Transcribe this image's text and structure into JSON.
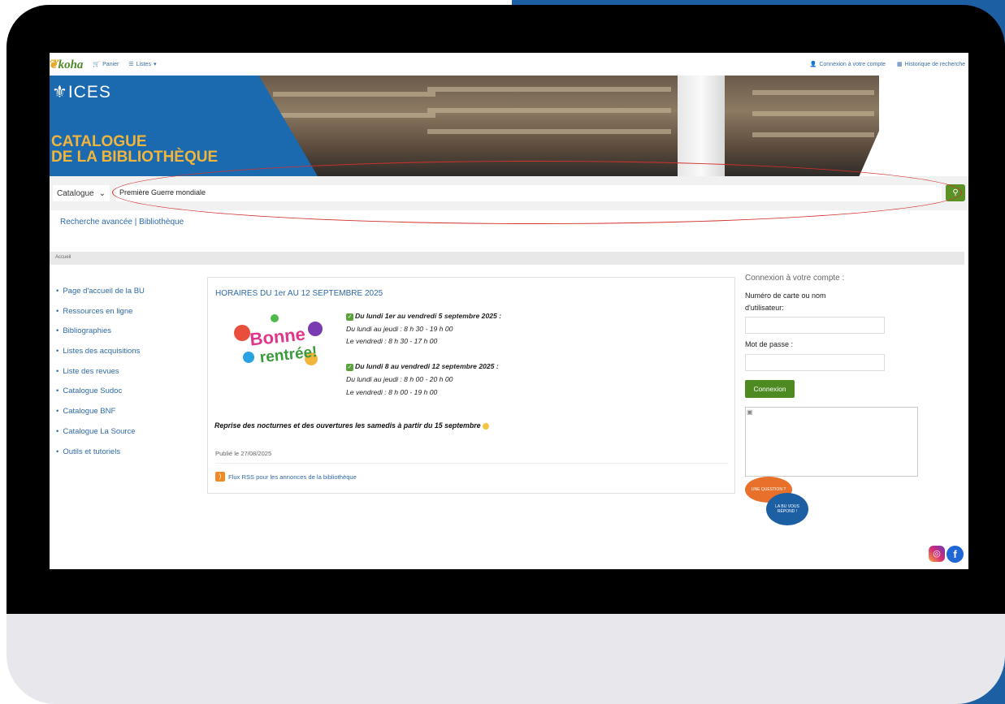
{
  "topnav": {
    "logo": "koha",
    "cart_label": "Panier",
    "lists_label": "Listes",
    "login_label": "Connexion à votre compte",
    "history_label": "Historique de recherche"
  },
  "banner": {
    "org": "ICES",
    "title_line1": "CATALOGUE",
    "title_line2": "DE LA BIBLIOTHÈQUE"
  },
  "search": {
    "scope": "Catalogue",
    "query": "Première Guerre mondiale",
    "advanced_label": "Recherche avancée | Bibliothèque"
  },
  "breadcrumb": "Accueil",
  "sidebar": {
    "items": [
      "Page d'accueil de la BU",
      "Ressources en ligne",
      "Bibliographies",
      "Listes des acquisitions",
      "Liste des revues",
      "Catalogue Sudoc",
      "Catalogue BNF",
      "Catalogue La Source",
      "Outils et tutoriels"
    ]
  },
  "news": {
    "title": "HORAIRES DU 1er AU 12 SEPTEMBRE 2025",
    "image_text1": "Bonne",
    "image_text2": "rentrée!",
    "period1_heading": "Du lundi 1er au vendredi 5 septembre 2025 :",
    "period1_line1": "Du lundi au jeudi : 8 h 30 - 19 h 00",
    "period1_line2": "Le vendredi : 8 h 30 - 17 h 00",
    "period2_heading": "Du lundi 8 au vendredi 12 septembre 2025 :",
    "period2_line1": "Du lundi au jeudi : 8 h 00 - 20 h 00",
    "period2_line2": "Le vendredi : 8 h 00 - 19 h 00",
    "reprise": "Reprise des nocturnes et des ouvertures les samedis à partir du 15 septembre",
    "published": "Publié le 27/08/2025",
    "rss": "Flux RSS pour les annonces de la bibliothèque"
  },
  "login": {
    "title": "Connexion à votre compte :",
    "card_label": "Numéro de carte ou nom d'utilisateur:",
    "password_label": "Mot de passe :",
    "button": "Connexion",
    "bubble1": "UNE QUESTION ?",
    "bubble2": "LA BU VOUS RÉPOND !"
  },
  "colors": {
    "brand_blue": "#1b6ab0",
    "accent_orange": "#f2b53c",
    "button_green": "#5a9226",
    "annotation_red": "#d4302d"
  }
}
